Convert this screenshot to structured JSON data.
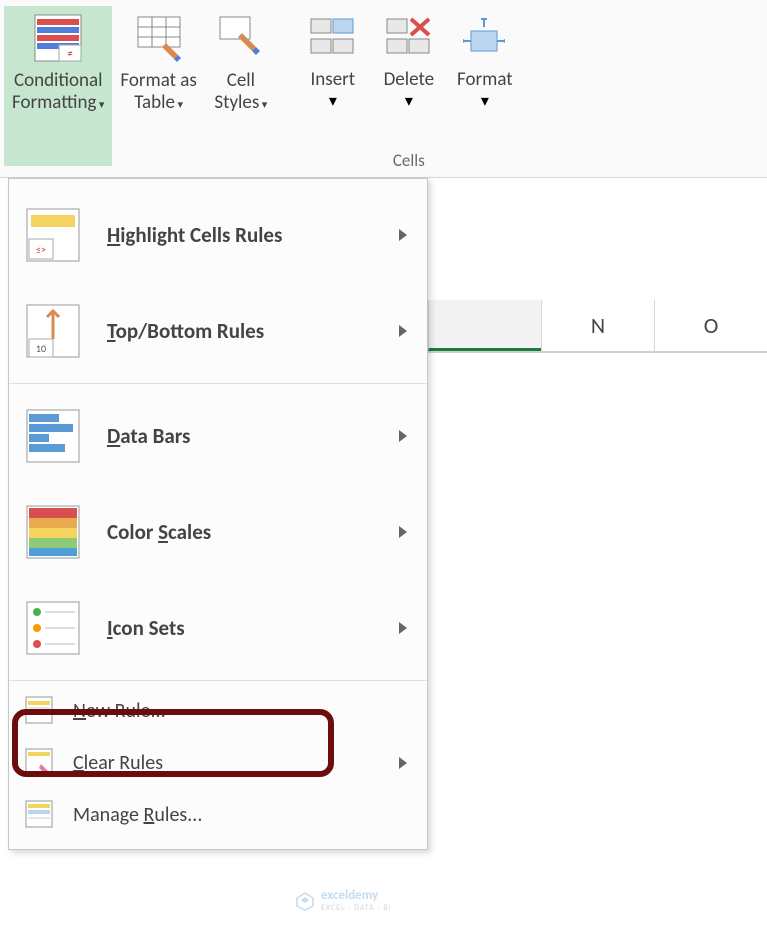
{
  "ribbon": {
    "styles_group": {
      "conditional_formatting": "Conditional\nFormatting",
      "format_as_table": "Format as\nTable",
      "cell_styles": "Cell\nStyles"
    },
    "cells_group": {
      "label": "Cells",
      "insert": "Insert",
      "delete": "Delete",
      "format": "Format"
    }
  },
  "menu": {
    "highlight": "Highlight Cells Rules",
    "topbottom": "Top/Bottom Rules",
    "databars": "Data Bars",
    "colorscales": "Color Scales",
    "iconsets": "Icon Sets",
    "newrule": "New Rule...",
    "clearrules": "Clear Rules",
    "managerules": "Manage Rules..."
  },
  "columns": {
    "n": "N",
    "o": "O"
  },
  "watermark": {
    "brand": "exceldemy",
    "sub": "EXCEL · DATA · BI"
  }
}
